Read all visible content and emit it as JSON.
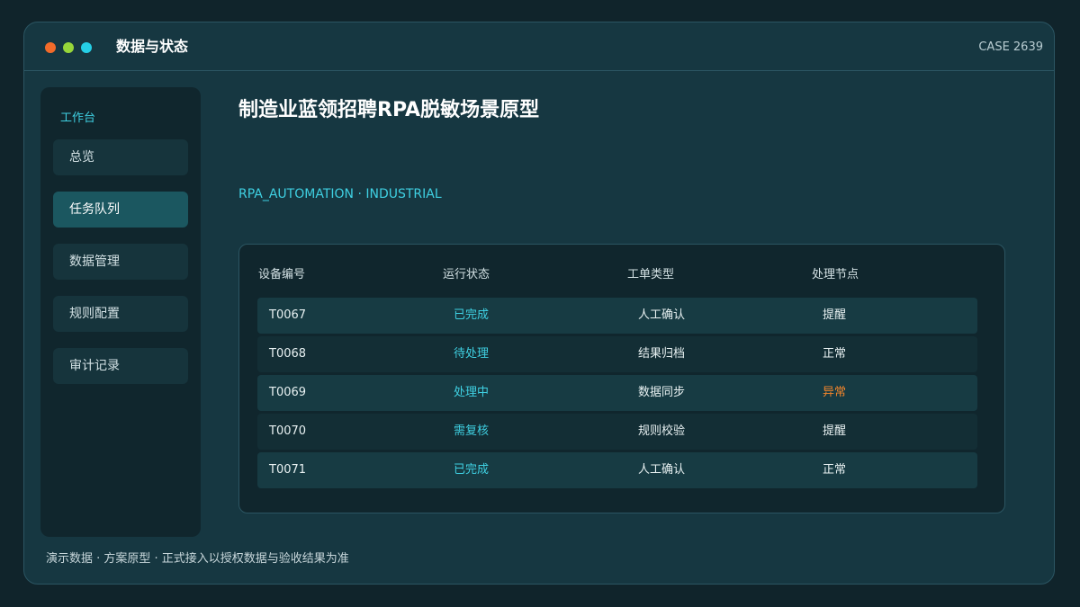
{
  "window": {
    "title": "数据与状态",
    "case_id": "CASE 2639"
  },
  "sidebar": {
    "heading": "工作台",
    "items": [
      {
        "label": "总览",
        "active": false
      },
      {
        "label": "任务队列",
        "active": true
      },
      {
        "label": "数据管理",
        "active": false
      },
      {
        "label": "规则配置",
        "active": false
      },
      {
        "label": "审计记录",
        "active": false
      }
    ]
  },
  "main": {
    "title": "制造业蓝领招聘RPA脱敏场景原型",
    "subtitle": "RPA_AUTOMATION · INDUSTRIAL"
  },
  "table": {
    "headers": [
      "设备编号",
      "运行状态",
      "工单类型",
      "处理节点"
    ],
    "rows": [
      {
        "id": "T0067",
        "status": "已完成",
        "type": "人工确认",
        "node": "提醒"
      },
      {
        "id": "T0068",
        "status": "待处理",
        "type": "结果归档",
        "node": "正常"
      },
      {
        "id": "T0069",
        "status": "处理中",
        "type": "数据同步",
        "node": "异常"
      },
      {
        "id": "T0070",
        "status": "需复核",
        "type": "规则校验",
        "node": "提醒"
      },
      {
        "id": "T0071",
        "status": "已完成",
        "type": "人工确认",
        "node": "正常"
      }
    ]
  },
  "footer": {
    "note": "演示数据 · 方案原型 · 正式接入以授权数据与验收结果为准"
  },
  "colors": {
    "accent": "#3fd0e2",
    "warning": "#f0842b",
    "window_bg": "#163741",
    "page_bg": "#10242b"
  }
}
